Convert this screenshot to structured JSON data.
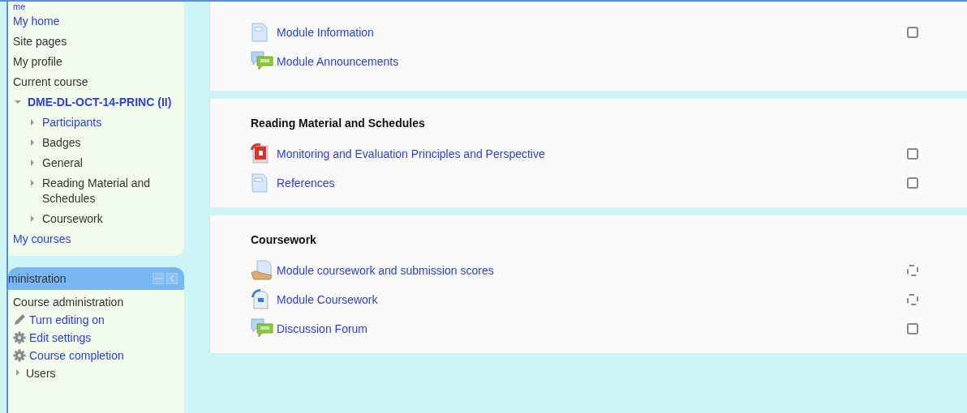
{
  "navigation": {
    "items": [
      {
        "label": "me",
        "link": true
      },
      {
        "label": "My home",
        "link": true
      },
      {
        "label": "Site pages",
        "link": false
      },
      {
        "label": "My profile",
        "link": false
      },
      {
        "label": "Current course",
        "link": false
      },
      {
        "label": "DME-DL-OCT-14-PRINC (II)",
        "link": true,
        "expanded": true,
        "children": [
          {
            "label": "Participants",
            "link": true,
            "expanded": false
          },
          {
            "label": "Badges",
            "link": false,
            "expanded": false
          },
          {
            "label": "General",
            "link": false,
            "expanded": false
          },
          {
            "label": "Reading Material and Schedules",
            "link": false,
            "expanded": false
          },
          {
            "label": "Coursework",
            "link": false,
            "expanded": false
          }
        ]
      },
      {
        "label": "My courses",
        "link": true
      }
    ]
  },
  "administration": {
    "title": "ministration",
    "items": [
      {
        "label": "Course administration",
        "link": false,
        "kind": "heading"
      },
      {
        "label": "Turn editing on",
        "link": true,
        "kind": "pencil"
      },
      {
        "label": "Edit settings",
        "link": true,
        "kind": "gear"
      },
      {
        "label": "Course completion",
        "link": true,
        "kind": "gear"
      },
      {
        "label": "Users",
        "link": false,
        "kind": "branch"
      }
    ]
  },
  "sections": [
    {
      "activities": [
        {
          "name": "Module Information",
          "kind": "page",
          "completion": {
            "kind": "manual",
            "checked": false
          }
        },
        {
          "name": "Module Announcements",
          "kind": "forum"
        }
      ]
    },
    {
      "title": "Reading Material and Schedules",
      "activities": [
        {
          "name": "Monitoring and Evaluation Principles and Perspective",
          "kind": "pdf",
          "completion": {
            "kind": "manual",
            "checked": false
          }
        },
        {
          "name": "References",
          "kind": "page",
          "completion": {
            "kind": "manual",
            "checked": false
          }
        }
      ]
    },
    {
      "title": "Coursework",
      "activities": [
        {
          "name": "Module coursework and submission scores",
          "kind": "assignment",
          "completion": {
            "kind": "auto",
            "checked": false
          }
        },
        {
          "name": "Module Coursework",
          "kind": "document",
          "completion": {
            "kind": "auto",
            "checked": false
          }
        },
        {
          "name": "Discussion Forum",
          "kind": "forum",
          "completion": {
            "kind": "manual",
            "checked": false
          }
        }
      ]
    }
  ]
}
